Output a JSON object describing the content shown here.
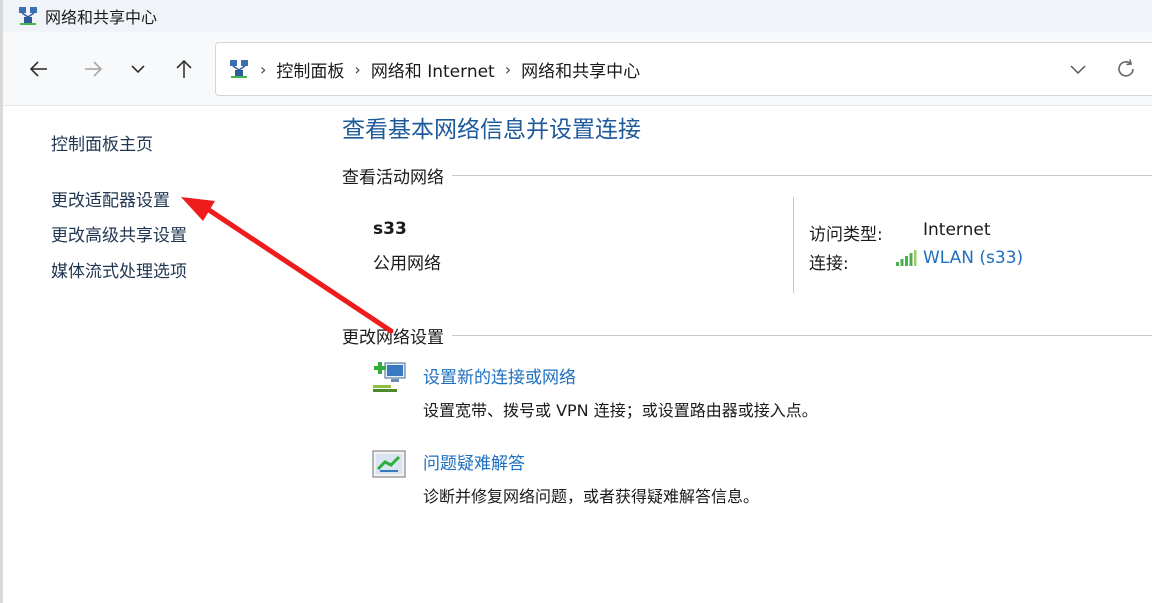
{
  "window": {
    "title": "网络和共享中心",
    "icon": "network-sharing-icon"
  },
  "nav": {
    "back_icon": "arrow-left-icon",
    "forward_icon": "arrow-right-icon",
    "recent_icon": "chevron-down-icon",
    "up_icon": "arrow-up-icon"
  },
  "address": {
    "crumbs": [
      "控制面板",
      "网络和 Internet",
      "网络和共享中心"
    ],
    "separator": "›",
    "dropdown_icon": "chevron-down-icon",
    "refresh_icon": "refresh-icon"
  },
  "sidebar": {
    "items": [
      {
        "label": "控制面板主页"
      },
      {
        "label": "更改适配器设置"
      },
      {
        "label": "更改高级共享设置"
      },
      {
        "label": "媒体流式处理选项"
      }
    ]
  },
  "main": {
    "title": "查看基本网络信息并设置连接",
    "active_section": "查看活动网络",
    "network": {
      "name": "s33",
      "type": "公用网络",
      "access_label": "访问类型:",
      "access_value": "Internet",
      "connection_label": "连接:",
      "connection_value": "WLAN (s33)",
      "connection_icon": "wifi-signal-icon"
    },
    "change_section": "更改网络设置",
    "tasks": [
      {
        "link": "设置新的连接或网络",
        "desc": "设置宽带、拨号或 VPN 连接；或设置路由器或接入点。",
        "icon": "new-connection-icon"
      },
      {
        "link": "问题疑难解答",
        "desc": "诊断并修复网络问题，或者获得疑难解答信息。",
        "icon": "troubleshoot-icon"
      }
    ]
  },
  "annotation": {
    "arrow_color": "#ee1c1c"
  },
  "colors": {
    "link": "#1e6fc0",
    "title": "#1e5a9a",
    "sidebar_link": "#1f3550"
  }
}
